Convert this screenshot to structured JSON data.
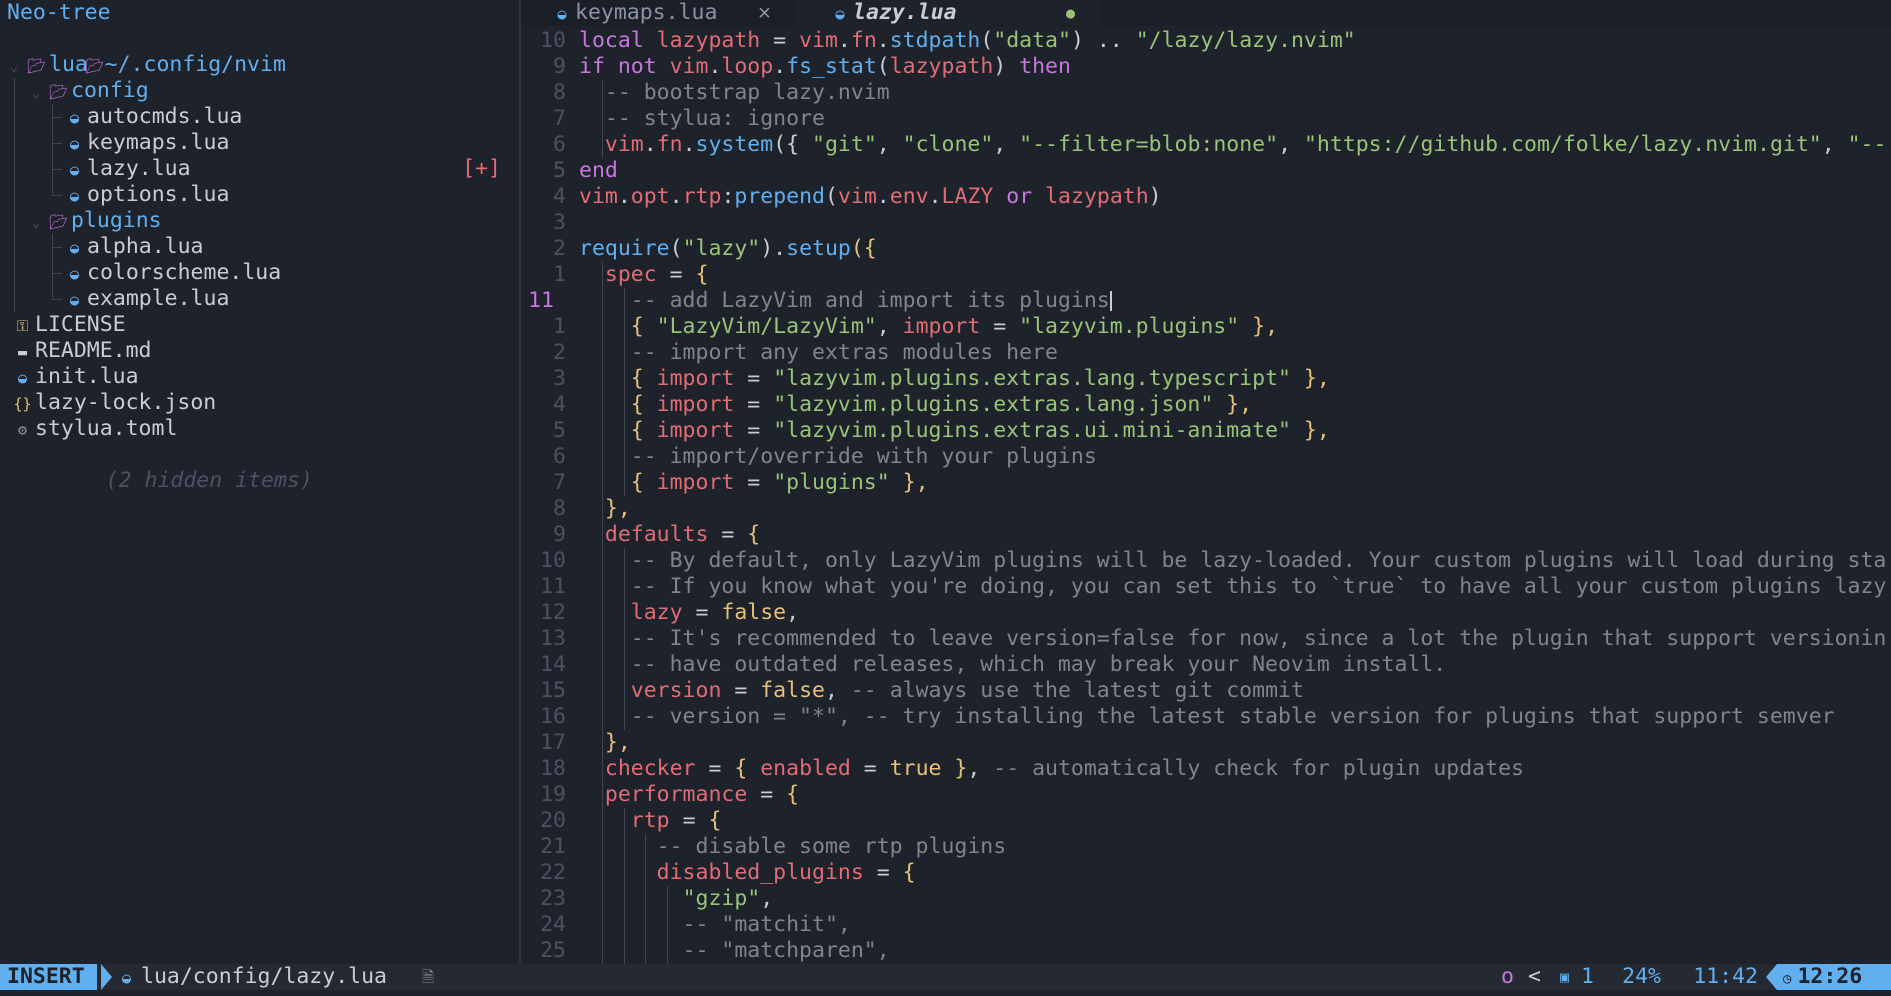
{
  "sidebar": {
    "title": "Neo-tree",
    "root": "~/.config/nvim",
    "hidden_note": "(2 hidden items)",
    "modified_marker": "[+]",
    "items": [
      {
        "name": "lua",
        "kind": "folder"
      },
      {
        "name": "config",
        "kind": "folder"
      },
      {
        "name": "autocmds.lua",
        "kind": "lua"
      },
      {
        "name": "keymaps.lua",
        "kind": "lua"
      },
      {
        "name": "lazy.lua",
        "kind": "lua"
      },
      {
        "name": "options.lua",
        "kind": "lua"
      },
      {
        "name": "plugins",
        "kind": "folder"
      },
      {
        "name": "alpha.lua",
        "kind": "lua"
      },
      {
        "name": "colorscheme.lua",
        "kind": "lua"
      },
      {
        "name": "example.lua",
        "kind": "lua"
      },
      {
        "name": "LICENSE",
        "kind": "license"
      },
      {
        "name": "README.md",
        "kind": "markdown"
      },
      {
        "name": "init.lua",
        "kind": "lua"
      },
      {
        "name": "lazy-lock.json",
        "kind": "json"
      },
      {
        "name": "stylua.toml",
        "kind": "config"
      }
    ]
  },
  "tabs": [
    {
      "label": "keymaps.lua",
      "active": false,
      "icon": "lua-icon"
    },
    {
      "label": "lazy.lua",
      "active": true,
      "modified": true,
      "icon": "lua-icon"
    }
  ],
  "editor": {
    "lines": [
      [
        "10",
        [
          [
            "local ",
            "kw"
          ],
          [
            "lazypath",
            "id"
          ],
          [
            " = ",
            "pu"
          ],
          [
            "vim",
            "id"
          ],
          [
            ".",
            "pu"
          ],
          [
            "fn",
            "id"
          ],
          [
            ".",
            "pu"
          ],
          [
            "stdpath",
            "fn"
          ],
          [
            "(",
            "pu"
          ],
          [
            "\"data\"",
            "st"
          ],
          [
            ") .. ",
            "pu"
          ],
          [
            "\"/lazy/lazy.nvim\"",
            "st"
          ]
        ],
        0
      ],
      [
        "9",
        [
          [
            "if ",
            "kw"
          ],
          [
            "not ",
            "kw"
          ],
          [
            "vim",
            "id"
          ],
          [
            ".",
            "pu"
          ],
          [
            "loop",
            "id"
          ],
          [
            ".",
            "pu"
          ],
          [
            "fs_stat",
            "fn"
          ],
          [
            "(",
            "pu"
          ],
          [
            "lazypath",
            "id"
          ],
          [
            ") ",
            "pu"
          ],
          [
            "then",
            "kw"
          ]
        ],
        0
      ],
      [
        "8",
        [
          [
            "  -- bootstrap lazy.nvim",
            "cm"
          ]
        ],
        1
      ],
      [
        "7",
        [
          [
            "  -- stylua: ignore",
            "cm"
          ]
        ],
        1
      ],
      [
        "6",
        [
          [
            "  ",
            "pu"
          ],
          [
            "vim",
            "id"
          ],
          [
            ".",
            "pu"
          ],
          [
            "fn",
            "id"
          ],
          [
            ".",
            "pu"
          ],
          [
            "system",
            "fn"
          ],
          [
            "({ ",
            "pu"
          ],
          [
            "\"git\"",
            "st"
          ],
          [
            ", ",
            "pu"
          ],
          [
            "\"clone\"",
            "st"
          ],
          [
            ", ",
            "pu"
          ],
          [
            "\"--filter=blob:none\"",
            "st"
          ],
          [
            ", ",
            "pu"
          ],
          [
            "\"https://github.com/folke/lazy.nvim.git\"",
            "st"
          ],
          [
            ", ",
            "pu"
          ],
          [
            "\"--",
            "st"
          ]
        ],
        1
      ],
      [
        "5",
        [
          [
            "end",
            "kw"
          ]
        ],
        0
      ],
      [
        "4",
        [
          [
            "vim",
            "id"
          ],
          [
            ".",
            "pu"
          ],
          [
            "opt",
            "id"
          ],
          [
            ".",
            "pu"
          ],
          [
            "rtp",
            "id"
          ],
          [
            ":",
            "pu"
          ],
          [
            "prepend",
            "fn"
          ],
          [
            "(",
            "pu"
          ],
          [
            "vim",
            "id"
          ],
          [
            ".",
            "pu"
          ],
          [
            "env",
            "id"
          ],
          [
            ".",
            "pu"
          ],
          [
            "LAZY",
            "id"
          ],
          [
            " or ",
            "kw"
          ],
          [
            "lazypath",
            "id"
          ],
          [
            ")",
            "pu"
          ]
        ],
        0
      ],
      [
        "3",
        [],
        0
      ],
      [
        "2",
        [
          [
            "require",
            "fn"
          ],
          [
            "(",
            "pu"
          ],
          [
            "\"lazy\"",
            "st"
          ],
          [
            ").",
            "pu"
          ],
          [
            "setup",
            "fn"
          ],
          [
            "({",
            "br"
          ]
        ],
        0
      ],
      [
        "1",
        [
          [
            "  ",
            "pu"
          ],
          [
            "spec",
            "id"
          ],
          [
            " = ",
            "pu"
          ],
          [
            "{",
            "br"
          ]
        ],
        1
      ],
      [
        "11",
        [
          [
            "    -- add LazyVim and import its plugins",
            "cm"
          ]
        ],
        2,
        "cur"
      ],
      [
        "1",
        [
          [
            "    { ",
            "br"
          ],
          [
            "\"LazyVim/LazyVim\"",
            "st"
          ],
          [
            ", ",
            "pu"
          ],
          [
            "import",
            "id"
          ],
          [
            " = ",
            "pu"
          ],
          [
            "\"lazyvim.plugins\"",
            "st"
          ],
          [
            " },",
            "br"
          ]
        ],
        2
      ],
      [
        "2",
        [
          [
            "    -- import any extras modules here",
            "cm"
          ]
        ],
        2
      ],
      [
        "3",
        [
          [
            "    { ",
            "br"
          ],
          [
            "import",
            "id"
          ],
          [
            " = ",
            "pu"
          ],
          [
            "\"lazyvim.plugins.extras.lang.typescript\"",
            "st"
          ],
          [
            " },",
            "br"
          ]
        ],
        2
      ],
      [
        "4",
        [
          [
            "    { ",
            "br"
          ],
          [
            "import",
            "id"
          ],
          [
            " = ",
            "pu"
          ],
          [
            "\"lazyvim.plugins.extras.lang.json\"",
            "st"
          ],
          [
            " },",
            "br"
          ]
        ],
        2
      ],
      [
        "5",
        [
          [
            "    { ",
            "br"
          ],
          [
            "import",
            "id"
          ],
          [
            " = ",
            "pu"
          ],
          [
            "\"lazyvim.plugins.extras.ui.mini-animate\"",
            "st"
          ],
          [
            " },",
            "br"
          ]
        ],
        2
      ],
      [
        "6",
        [
          [
            "    -- import/override with your plugins",
            "cm"
          ]
        ],
        2
      ],
      [
        "7",
        [
          [
            "    { ",
            "br"
          ],
          [
            "import",
            "id"
          ],
          [
            " = ",
            "pu"
          ],
          [
            "\"plugins\"",
            "st"
          ],
          [
            " },",
            "br"
          ]
        ],
        2
      ],
      [
        "8",
        [
          [
            "  },",
            "br"
          ]
        ],
        1
      ],
      [
        "9",
        [
          [
            "  ",
            "pu"
          ],
          [
            "defaults",
            "id"
          ],
          [
            " = ",
            "pu"
          ],
          [
            "{",
            "br"
          ]
        ],
        1
      ],
      [
        "10",
        [
          [
            "    -- By default, only LazyVim plugins will be lazy-loaded. Your custom plugins will load during sta",
            "cm"
          ]
        ],
        2
      ],
      [
        "11",
        [
          [
            "    -- If you know what you're doing, you can set this to `true` to have all your custom plugins lazy",
            "cm"
          ]
        ],
        2
      ],
      [
        "12",
        [
          [
            "    ",
            "pu"
          ],
          [
            "lazy",
            "id"
          ],
          [
            " = ",
            "pu"
          ],
          [
            "false",
            "bo"
          ],
          [
            ",",
            "pu"
          ]
        ],
        2
      ],
      [
        "13",
        [
          [
            "    -- It's recommended to leave version=false for now, since a lot the plugin that support versionin",
            "cm"
          ]
        ],
        2
      ],
      [
        "14",
        [
          [
            "    -- have outdated releases, which may break your Neovim install.",
            "cm"
          ]
        ],
        2
      ],
      [
        "15",
        [
          [
            "    ",
            "pu"
          ],
          [
            "version",
            "id"
          ],
          [
            " = ",
            "pu"
          ],
          [
            "false",
            "bo"
          ],
          [
            ", ",
            "pu"
          ],
          [
            "-- always use the latest git commit",
            "cm"
          ]
        ],
        2
      ],
      [
        "16",
        [
          [
            "    -- version = \"*\", -- try installing the latest stable version for plugins that support semver",
            "cm"
          ]
        ],
        2
      ],
      [
        "17",
        [
          [
            "  },",
            "br"
          ]
        ],
        1
      ],
      [
        "18",
        [
          [
            "  ",
            "pu"
          ],
          [
            "checker",
            "id"
          ],
          [
            " = ",
            "pu"
          ],
          [
            "{ ",
            "br"
          ],
          [
            "enabled",
            "id"
          ],
          [
            " = ",
            "pu"
          ],
          [
            "true",
            "bo"
          ],
          [
            " }",
            "br"
          ],
          [
            ", ",
            "pu"
          ],
          [
            "-- automatically check for plugin updates",
            "cm"
          ]
        ],
        1
      ],
      [
        "19",
        [
          [
            "  ",
            "pu"
          ],
          [
            "performance",
            "id"
          ],
          [
            " = ",
            "pu"
          ],
          [
            "{",
            "br"
          ]
        ],
        1
      ],
      [
        "20",
        [
          [
            "    ",
            "pu"
          ],
          [
            "rtp",
            "id"
          ],
          [
            " = ",
            "pu"
          ],
          [
            "{",
            "br"
          ]
        ],
        2
      ],
      [
        "21",
        [
          [
            "      -- disable some rtp plugins",
            "cm"
          ]
        ],
        3
      ],
      [
        "22",
        [
          [
            "      ",
            "pu"
          ],
          [
            "disabled_plugins",
            "id"
          ],
          [
            " = ",
            "pu"
          ],
          [
            "{",
            "br"
          ]
        ],
        3
      ],
      [
        "23",
        [
          [
            "        ",
            "pu"
          ],
          [
            "\"gzip\"",
            "st"
          ],
          [
            ",",
            "pu"
          ]
        ],
        4
      ],
      [
        "24",
        [
          [
            "        -- \"matchit\",",
            "cm"
          ]
        ],
        4
      ],
      [
        "25",
        [
          [
            "        -- \"matchparen\",",
            "cm"
          ]
        ],
        4
      ]
    ]
  },
  "statusline": {
    "mode": "INSERT",
    "file": "lua/config/lazy.lua",
    "o_label": "o",
    "chevron": "<",
    "count": "1",
    "percent": "24%",
    "position": "11:42",
    "clock": "12:26"
  },
  "colors": {
    "accent": "#61afef",
    "keyword": "#c678dd",
    "string": "#98c379",
    "identifier": "#e06c75",
    "comment": "#7f848e",
    "background": "#1e222a"
  }
}
